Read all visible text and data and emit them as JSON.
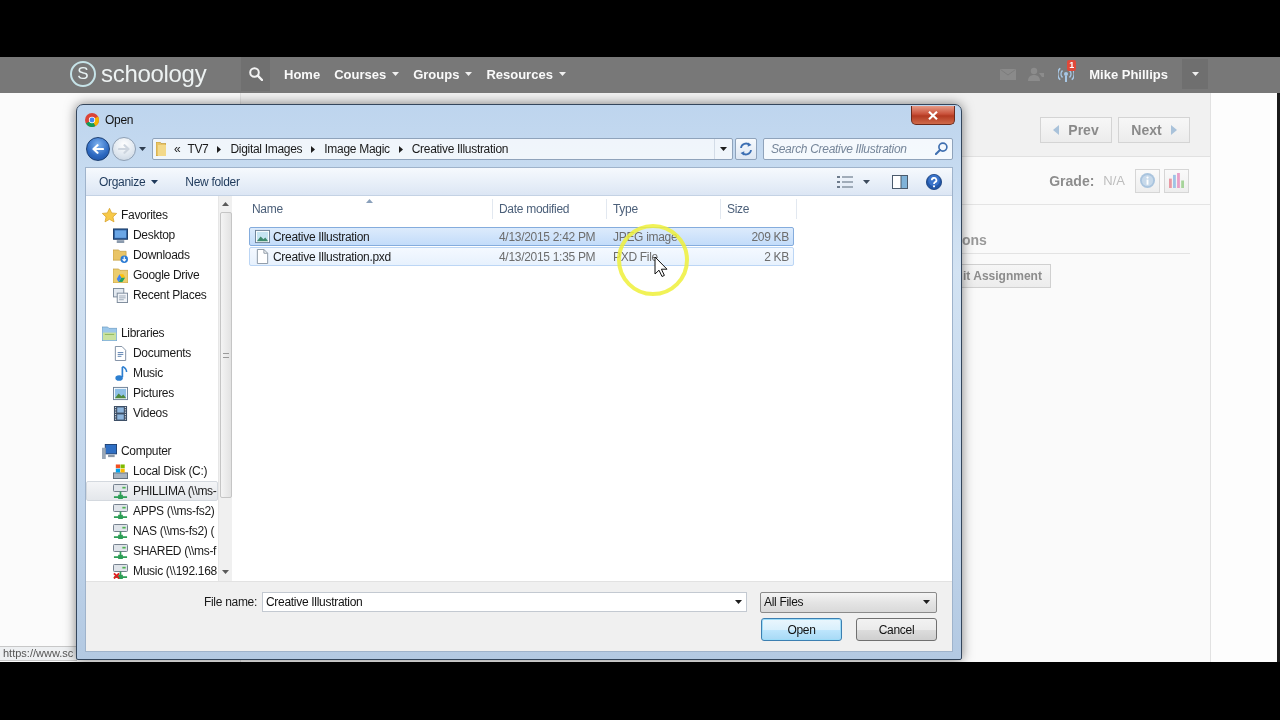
{
  "page": {
    "nav": {
      "logo_mark": "S",
      "logo": "schoology",
      "menu": [
        {
          "label": "Home",
          "dropdown": false
        },
        {
          "label": "Courses",
          "dropdown": true
        },
        {
          "label": "Groups",
          "dropdown": true
        },
        {
          "label": "Resources",
          "dropdown": true
        }
      ],
      "notification_count": "1",
      "user_name": "Mike Phillips"
    },
    "pager": {
      "prev": "Prev",
      "next": "Next"
    },
    "grade": {
      "label": "Grade:",
      "value": "N/A"
    },
    "section_heading": "ons",
    "submit_button": "it Assignment",
    "status_url": "https://www.sc"
  },
  "dialog": {
    "title": "Open",
    "back": {
      "disabled": false
    },
    "forward": {
      "disabled": true
    },
    "breadcrumb": {
      "overflow": "«",
      "items": [
        "TV7",
        "Digital Images",
        "Image Magic",
        "Creative Illustration"
      ]
    },
    "search": {
      "placeholder": "Search Creative Illustration"
    },
    "toolbar": {
      "organize": "Organize",
      "new_folder": "New folder"
    },
    "navigation_pane": [
      {
        "label": "Favorites",
        "kind": "favorites",
        "hovered": false,
        "children": [
          {
            "label": "Desktop",
            "kind": "desktop",
            "hovered": false
          },
          {
            "label": "Downloads",
            "kind": "downloads",
            "hovered": false
          },
          {
            "label": "Google Drive",
            "kind": "cloud-folder",
            "hovered": false
          },
          {
            "label": "Recent Places",
            "kind": "recent",
            "hovered": false
          }
        ]
      },
      {
        "label": "Libraries",
        "kind": "libraries",
        "hovered": false,
        "children": [
          {
            "label": "Documents",
            "kind": "documents",
            "hovered": false
          },
          {
            "label": "Music",
            "kind": "music",
            "hovered": false
          },
          {
            "label": "Pictures",
            "kind": "pictures",
            "hovered": false
          },
          {
            "label": "Videos",
            "kind": "videos",
            "hovered": false
          }
        ]
      },
      {
        "label": "Computer",
        "kind": "computer",
        "hovered": false,
        "children": [
          {
            "label": "Local Disk (C:)",
            "kind": "local-disk",
            "hovered": false
          },
          {
            "label": "PHILLIMA (\\\\ms-",
            "kind": "network-drive",
            "hovered": true
          },
          {
            "label": "APPS (\\\\ms-fs2)",
            "kind": "network-drive",
            "hovered": false
          },
          {
            "label": "NAS (\\\\ms-fs2) (",
            "kind": "network-drive",
            "hovered": false
          },
          {
            "label": "SHARED (\\\\ms-f",
            "kind": "network-drive",
            "hovered": false
          },
          {
            "label": "Music (\\\\192.168",
            "kind": "offline-drive",
            "hovered": false
          }
        ]
      }
    ],
    "columns": [
      {
        "label": "Name",
        "sorted": true
      },
      {
        "label": "Date modified",
        "sorted": false
      },
      {
        "label": "Type",
        "sorted": false
      },
      {
        "label": "Size",
        "sorted": false
      }
    ],
    "files": [
      {
        "name": "Creative Illustration",
        "date": "4/13/2015 2:42 PM",
        "type": "JPEG image",
        "size": "209 KB",
        "kind": "image",
        "selected": true,
        "hovered": false
      },
      {
        "name": "Creative Illustration.pxd",
        "date": "4/13/2015 1:35 PM",
        "type": "PXD File",
        "size": "2 KB",
        "kind": "file",
        "selected": false,
        "hovered": true
      }
    ],
    "file_name": {
      "label": "File name:",
      "value": "Creative Illustration"
    },
    "file_type": "All Files",
    "buttons": [
      {
        "label": "Open",
        "default": true
      },
      {
        "label": "Cancel",
        "default": false
      }
    ]
  }
}
